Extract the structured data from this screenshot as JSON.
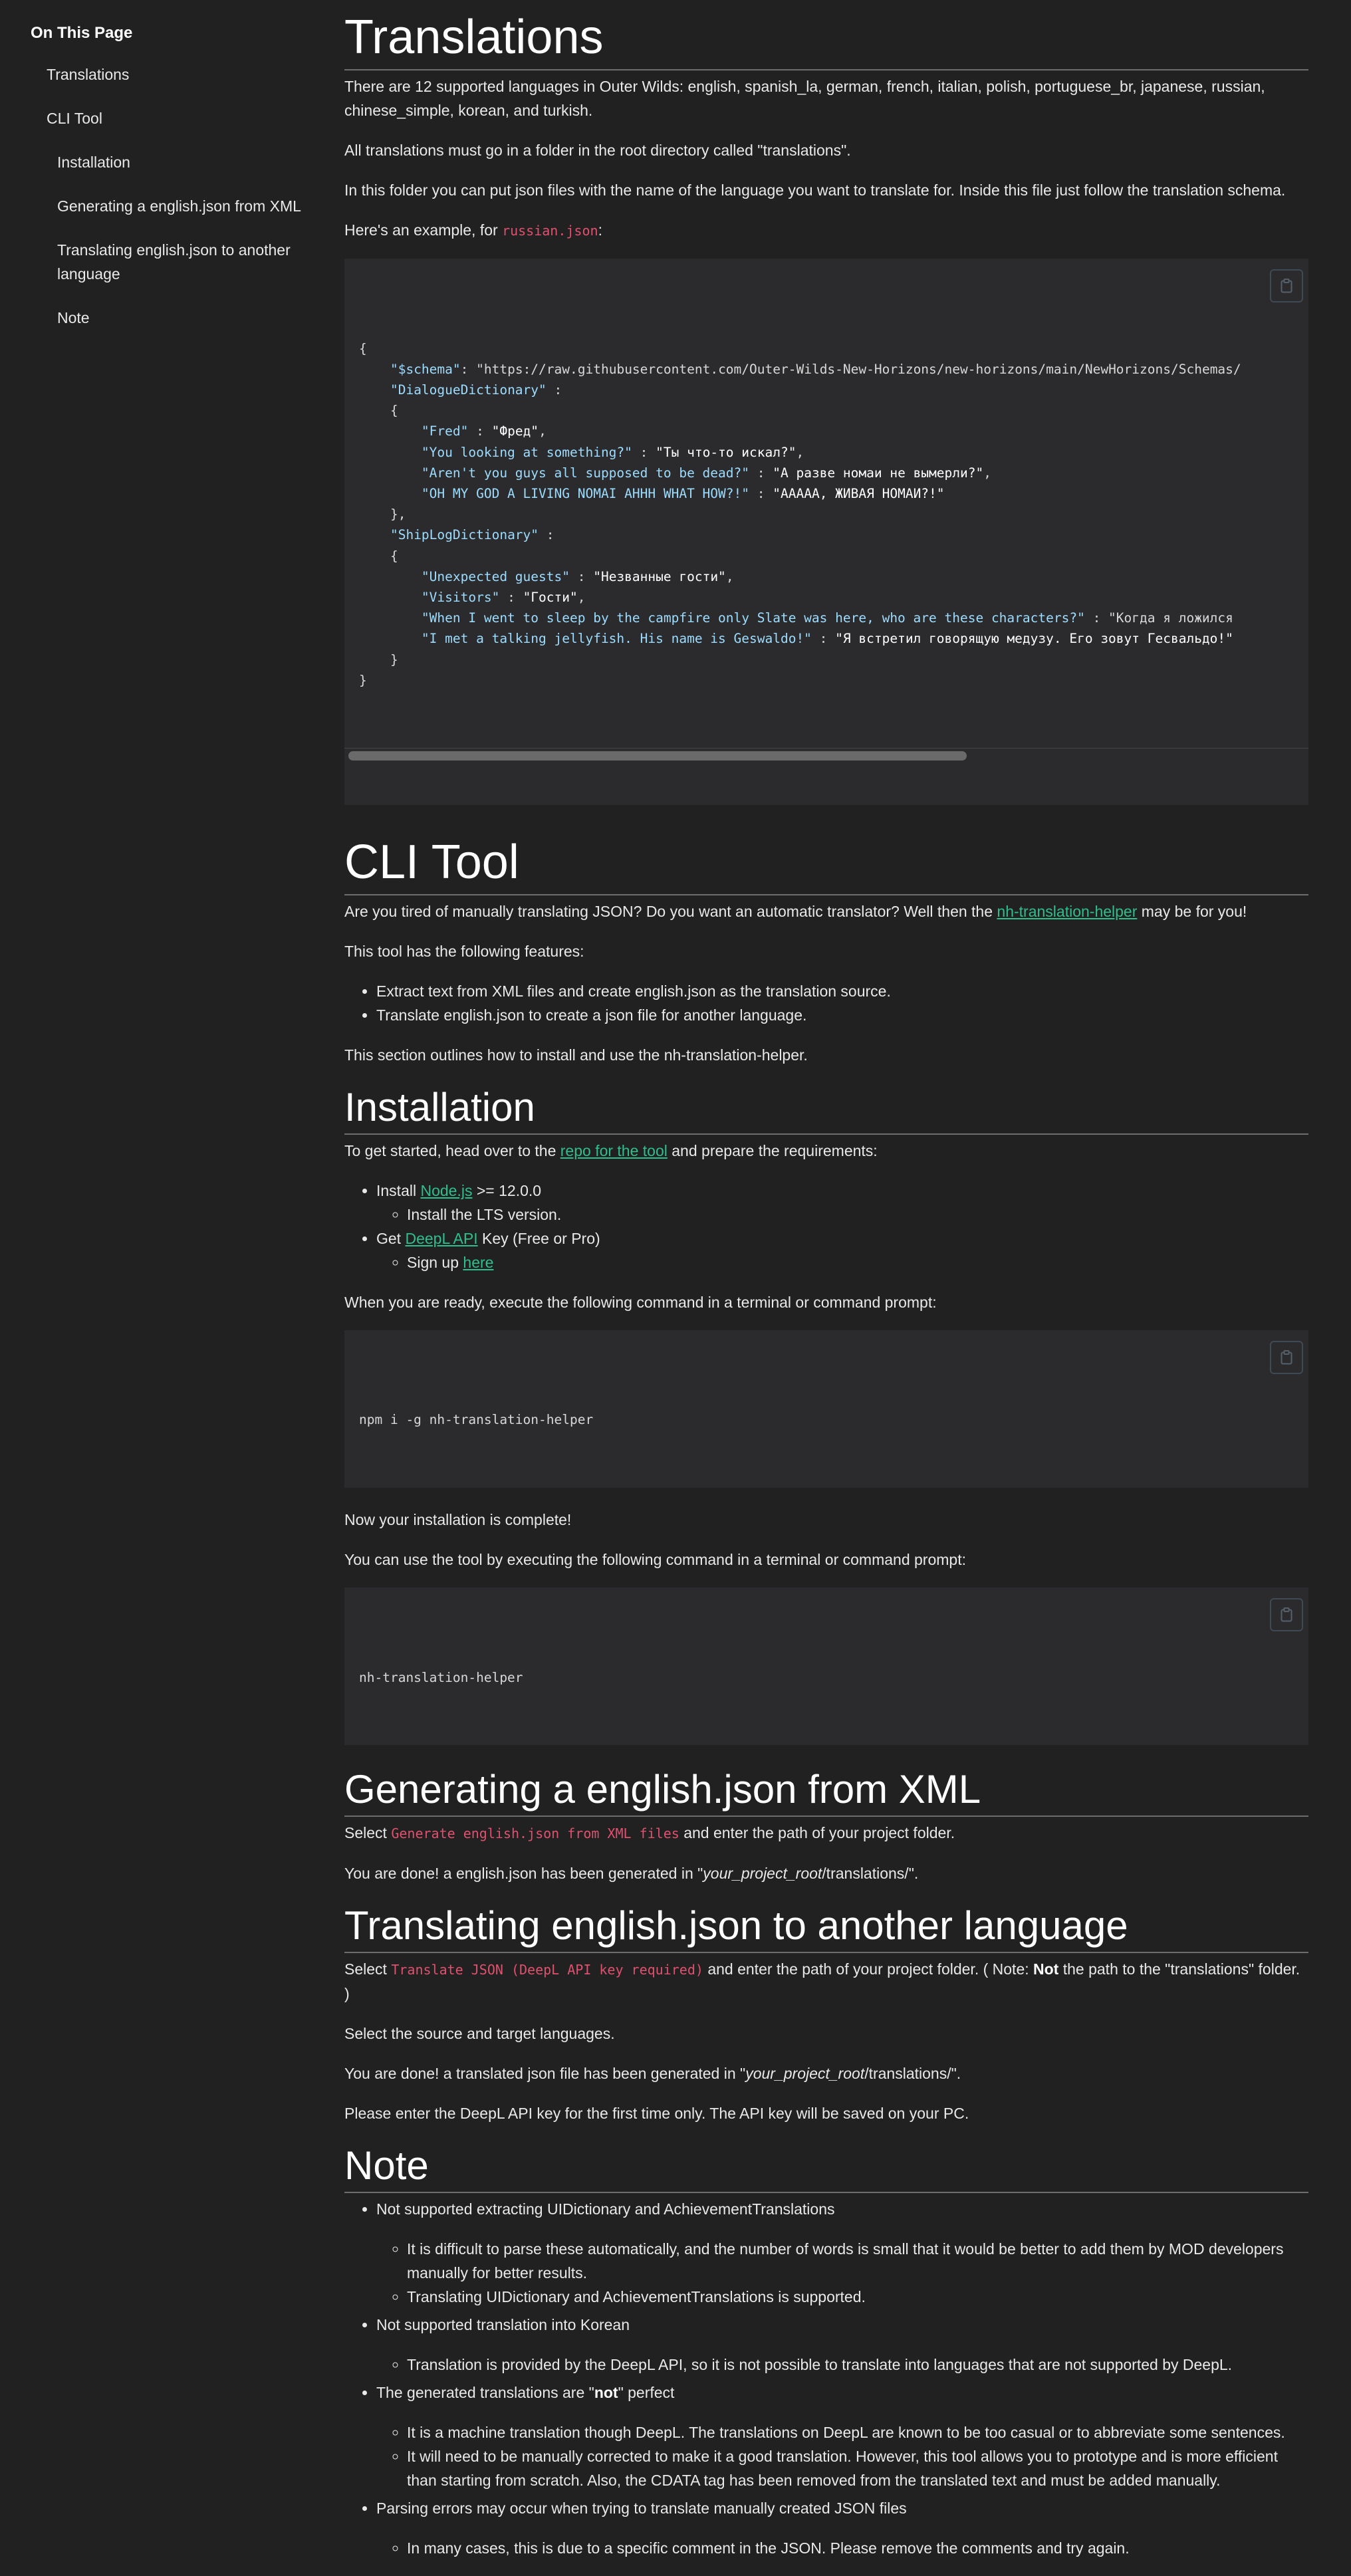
{
  "sidebar": {
    "title": "On This Page",
    "items": [
      {
        "label": "Translations",
        "level": 1
      },
      {
        "label": "CLI Tool",
        "level": 1
      },
      {
        "label": "Installation",
        "level": 2
      },
      {
        "label": "Generating a english.json from XML",
        "level": 2
      },
      {
        "label": "Translating english.json to another language",
        "level": 2
      },
      {
        "label": "Note",
        "level": 2
      }
    ]
  },
  "translations": {
    "heading": "Translations",
    "p1": "There are 12 supported languages in Outer Wilds: english, spanish_la, german, french, italian, polish, portuguese_br, japanese, russian, chinese_simple, korean, and turkish.",
    "p2": "All translations must go in a folder in the root directory called \"translations\".",
    "p3": "In this folder you can put json files with the name of the language you want to translate for. Inside this file just follow the translation schema.",
    "p4_prefix": "Here's an example, for ",
    "p4_code": "russian.json",
    "p4_suffix": ":",
    "code_lines": [
      "{",
      "    \"$schema\": \"https://raw.githubusercontent.com/Outer-Wilds-New-Horizons/new-horizons/main/NewHorizons/Schemas/",
      "    \"DialogueDictionary\" :",
      "    {",
      "        \"Fred\" : \"Фред\",",
      "        \"You looking at something?\" : \"Ты что-то искал?\",",
      "        \"Aren't you guys all supposed to be dead?\" : \"А разве номаи не вымерли?\",",
      "        \"OH MY GOD A LIVING NOMAI AHHH WHAT HOW?!\" : \"АААAA, ЖИВАЯ НОМАИ?!\"",
      "    },",
      "    \"ShipLogDictionary\" :",
      "    {",
      "        \"Unexpected guests\" : \"Незванные гости\",",
      "        \"Visitors\" : \"Гости\",",
      "        \"When I went to sleep by the campfire only Slate was here, who are these characters?\" : \"Когда я ложился",
      "        \"I met a talking jellyfish. His name is Geswaldo!\" : \"Я встретил говорящую медузу. Его зовут Гесвальдо!\"",
      "    }",
      "}"
    ]
  },
  "cli": {
    "heading": "CLI Tool",
    "p1_prefix": "Are you tired of manually translating JSON? Do you want an automatic translator? Well then the ",
    "p1_link": "nh-translation-helper",
    "p1_suffix": " may be for you!",
    "p2": "This tool has the following features:",
    "features": [
      "Extract text from XML files and create english.json as the translation source.",
      "Translate english.json to create a json file for another language."
    ],
    "p3": "This section outlines how to install and use the nh-translation-helper."
  },
  "installation": {
    "heading": "Installation",
    "p1_prefix": "To get started, head over to the ",
    "p1_link": "repo for the tool",
    "p1_suffix": " and prepare the requirements:",
    "req1_prefix": "Install ",
    "req1_link": "Node.js",
    "req1_suffix": " >= 12.0.0",
    "req1_sub": "Install the LTS version.",
    "req2_prefix": "Get ",
    "req2_link": "DeepL API",
    "req2_suffix": " Key (Free or Pro)",
    "req2_sub_prefix": "Sign up ",
    "req2_sub_link": "here",
    "p2": "When you are ready, execute the following command in a terminal or command prompt:",
    "cmd_install": "npm i -g nh-translation-helper",
    "p3": "Now your installation is complete!",
    "p4": "You can use the tool by executing the following command in a terminal or command prompt:",
    "cmd_run": "nh-translation-helper"
  },
  "generating": {
    "heading": "Generating a english.json from XML",
    "p1_prefix": "Select ",
    "p1_code": "Generate english.json from XML files",
    "p1_suffix": " and enter the path of your project folder.",
    "p2_prefix": "You are done! a english.json has been generated in \"",
    "p2_em": "your_project_root",
    "p2_suffix": "/translations/\"."
  },
  "translating": {
    "heading": "Translating english.json to another language",
    "p1_prefix": "Select ",
    "p1_code": "Translate JSON (DeepL API key required)",
    "p1_mid": " and enter the path of your project folder. ( Note: ",
    "p1_bold": "Not",
    "p1_suffix": " the path to the \"translations\" folder. )",
    "p2": "Select the source and target languages.",
    "p3_prefix": "You are done! a translated json file has been generated in \"",
    "p3_em": "your_project_root",
    "p3_suffix": "/translations/\".",
    "p4": "Please enter the DeepL API key for the first time only. The API key will be saved on your PC."
  },
  "note": {
    "heading": "Note",
    "item1": "Not supported extracting UIDictionary and AchievementTranslations",
    "item1_sub1": "It is difficult to parse these automatically, and the number of words is small that it would be better to add them by MOD developers manually for better results.",
    "item1_sub2": "Translating UIDictionary and AchievementTranslations is supported.",
    "item2": "Not supported translation into Korean",
    "item2_sub1": "Translation is provided by the DeepL API, so it is not possible to translate into languages that are not supported by DeepL.",
    "item3_prefix": "The generated translations are \"",
    "item3_bold": "not",
    "item3_suffix": "\" perfect",
    "item3_sub1": "It is a machine translation though DeepL. The translations on DeepL are known to be too casual or to abbreviate some sentences.",
    "item3_sub2": "It will need to be manually corrected to make it a good translation. However, this tool allows you to prototype and is more efficient than starting from scratch. Also, the CDATA tag has been removed from the translated text and must be added manually.",
    "item4": "Parsing errors may occur when trying to translate manually created JSON files",
    "item4_sub1": "In many cases, this is due to a specific comment in the JSON. Please remove the comments and try again."
  },
  "colors": {
    "background": "#212121",
    "link": "#2fbf8c",
    "inline_code": "#e0506f",
    "code_key": "#9cdcfe"
  },
  "icons": {
    "copy": "clipboard-icon"
  }
}
